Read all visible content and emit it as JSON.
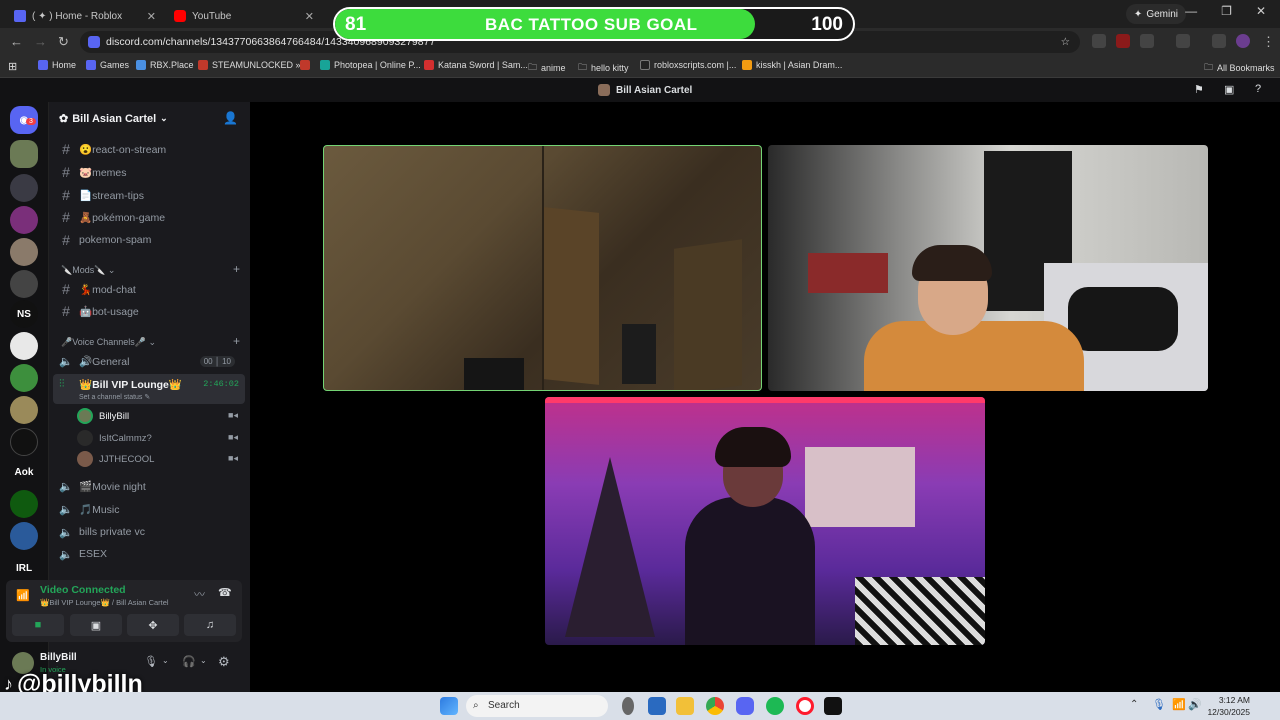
{
  "browser": {
    "tabs": [
      {
        "label": "( ✦ ) Home - Roblox",
        "color": "#5865f2"
      },
      {
        "label": "YouTube",
        "color": "#ff0000"
      }
    ],
    "gemini_label": "Gemini",
    "url": "discord.com/channels/1343770663864766484/1433409689093279877",
    "bookmarks": [
      {
        "label": "Home",
        "color": "#5865f2"
      },
      {
        "label": "Games",
        "color": "#5865f2"
      },
      {
        "label": "RBX.Place",
        "color": "#4a90e2"
      },
      {
        "label": "STEAMUNLOCKED »...",
        "color": "#c0392b"
      },
      {
        "label": "",
        "color": "#c0392b"
      },
      {
        "label": "Photopea | Online P...",
        "color": "#18a497"
      },
      {
        "label": "Katana Sword | Sam...",
        "color": "#d32f2f"
      },
      {
        "label": "anime",
        "color": "#999999"
      },
      {
        "label": "hello kitty",
        "color": "#999999"
      },
      {
        "label": "robloxscripts.com |...",
        "color": "#222222"
      },
      {
        "label": "kisskh | Asian Dram...",
        "color": "#f39c12"
      }
    ],
    "all_bookmarks": "All Bookmarks"
  },
  "overlay": {
    "goal_current": "81",
    "goal_title": "BAC TATTOO SUB GOAL",
    "goal_max": "100",
    "goal_progress": 0.81,
    "handle": "@billybilln"
  },
  "discord": {
    "title": "Bill Asian Cartel",
    "server_name": "Bill Asian Cartel",
    "rail_badge": "3",
    "rail_labels": [
      "NS",
      "Aok",
      "IRL"
    ],
    "channels": [
      {
        "icon": "#",
        "name": "😮react-on-stream"
      },
      {
        "icon": "#",
        "name": "🐷memes"
      },
      {
        "icon": "#",
        "name": "📄stream-tips"
      },
      {
        "icon": "#",
        "name": "🧸pokémon-game"
      },
      {
        "icon": "#",
        "name": "pokemon-spam"
      }
    ],
    "mods_category": "🔪Mods🔪",
    "mod_channels": [
      {
        "icon": "#",
        "name": "💃mod-chat"
      },
      {
        "icon": "#",
        "name": "🤖bot-usage"
      }
    ],
    "voice_category": "🎤Voice Channels🎤",
    "general": {
      "name": "🔊General",
      "count_a": "00",
      "count_b": "10"
    },
    "vip": {
      "name": "👑Bill VIP Lounge👑",
      "timer": "2:46:02",
      "status": "Set a channel status"
    },
    "voice_users": [
      "BillyBill",
      "IsItCalmmz?",
      "JJTHECOOL"
    ],
    "more_voice": [
      "🎬Movie night",
      "🎵Music",
      "bills private vc",
      "ESEX"
    ],
    "voice_status": "Video Connected",
    "voice_location": "👑Bill VIP Lounge👑 / Bill Asian Cartel",
    "me": {
      "name": "BillyBill",
      "status": "In voice"
    }
  },
  "taskbar": {
    "search": "Search",
    "time": "3:12 AM",
    "date": "12/30/2025"
  }
}
